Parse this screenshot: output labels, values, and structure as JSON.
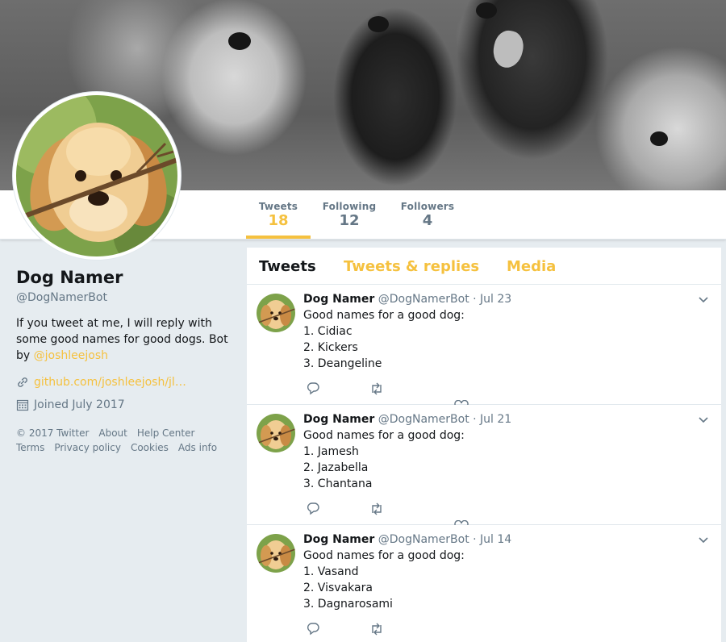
{
  "colors": {
    "accent": "#f5c13f",
    "muted": "#657786",
    "text": "#14171a",
    "background": "#e6ecf0"
  },
  "nav": {
    "stats": [
      {
        "label": "Tweets",
        "value": "18",
        "active": true
      },
      {
        "label": "Following",
        "value": "12",
        "active": false
      },
      {
        "label": "Followers",
        "value": "4",
        "active": false
      }
    ]
  },
  "profile": {
    "name": "Dog Namer",
    "handle": "@DogNamerBot",
    "bio_text": "If you tweet at me, I will reply with some good names for good dogs. Bot by ",
    "bio_mention": "@joshleejosh",
    "link": "github.com/joshleejosh/jl…",
    "joined": "Joined July 2017",
    "link_icon": "link-icon",
    "calendar_icon": "calendar-icon"
  },
  "footer": {
    "items": [
      "© 2017 Twitter",
      "About",
      "Help Center",
      "Terms",
      "Privacy policy",
      "Cookies",
      "Ads info"
    ]
  },
  "tabs": [
    {
      "label": "Tweets",
      "active": true
    },
    {
      "label": "Tweets & replies",
      "active": false
    },
    {
      "label": "Media",
      "active": false
    }
  ],
  "tweets": [
    {
      "name": "Dog Namer",
      "handle": "@DogNamerBot",
      "date": "· Jul 23",
      "lines": [
        "Good names for a good dog:",
        "1. Cidiac",
        "2. Kickers",
        "3. Deangeline"
      ]
    },
    {
      "name": "Dog Namer",
      "handle": "@DogNamerBot",
      "date": "· Jul 21",
      "lines": [
        "Good names for a good dog:",
        "1. Jamesh",
        "2. Jazabella",
        "3. Chantana"
      ]
    },
    {
      "name": "Dog Namer",
      "handle": "@DogNamerBot",
      "date": "· Jul 14",
      "lines": [
        "Good names for a good dog:",
        "1. Vasand",
        "2. Visvakara",
        "3. Dagnarosami"
      ]
    }
  ]
}
